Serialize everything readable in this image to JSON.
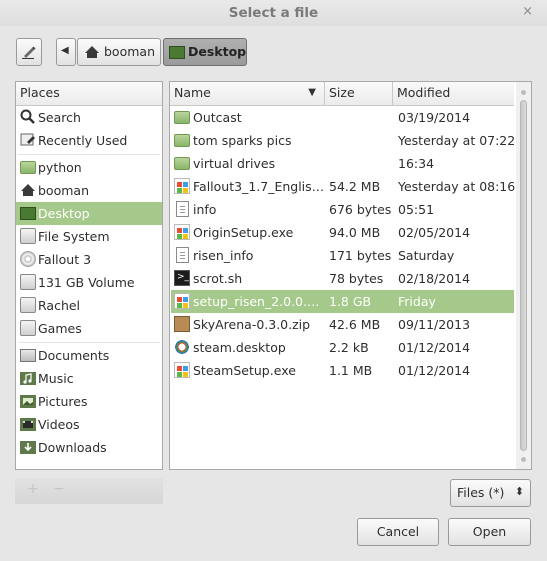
{
  "window": {
    "title": "Select a file",
    "close_glyph": "×"
  },
  "toolbar": {
    "edit_icon": "pencil-icon",
    "back_glyph": "◀",
    "path": [
      {
        "label": "booman",
        "icon": "home-icon"
      },
      {
        "label": "Desktop",
        "icon": "desktop-icon"
      }
    ]
  },
  "places": {
    "header": "Places",
    "groups": [
      [
        {
          "label": "Search",
          "icon": "search-icon"
        },
        {
          "label": "Recently Used",
          "icon": "recent-icon"
        }
      ],
      [
        {
          "label": "python",
          "icon": "folder-icon"
        },
        {
          "label": "booman",
          "icon": "home-icon"
        },
        {
          "label": "Desktop",
          "icon": "desktop-icon",
          "selected": true
        },
        {
          "label": "File System",
          "icon": "drive-icon"
        },
        {
          "label": "Fallout 3",
          "icon": "disc-icon"
        },
        {
          "label": "131 GB Volume",
          "icon": "drive-icon"
        },
        {
          "label": "Rachel",
          "icon": "drive-icon"
        },
        {
          "label": "Games",
          "icon": "drive-icon"
        }
      ],
      [
        {
          "label": "Documents",
          "icon": "documents-icon"
        },
        {
          "label": "Music",
          "icon": "music-icon"
        },
        {
          "label": "Pictures",
          "icon": "pictures-icon"
        },
        {
          "label": "Videos",
          "icon": "videos-icon"
        },
        {
          "label": "Downloads",
          "icon": "downloads-icon"
        }
      ]
    ],
    "add_glyph": "+",
    "remove_glyph": "−"
  },
  "files": {
    "columns": {
      "name": "Name",
      "size": "Size",
      "modified": "Modified",
      "sort_glyph": "▼"
    },
    "rows": [
      {
        "name": "Outcast",
        "size": "",
        "modified": "03/19/2014",
        "icon": "folder-icon"
      },
      {
        "name": "tom sparks pics",
        "size": "",
        "modified": "Yesterday at 07:22",
        "icon": "folder-icon"
      },
      {
        "name": "virtual drives",
        "size": "",
        "modified": "16:34",
        "icon": "folder-icon"
      },
      {
        "name": "Fallout3_1.7_Englis…",
        "size": "54.2 MB",
        "modified": "Yesterday at 08:16",
        "icon": "executable-icon"
      },
      {
        "name": "info",
        "size": "676 bytes",
        "modified": "05:51",
        "icon": "text-file-icon"
      },
      {
        "name": "OriginSetup.exe",
        "size": "94.0 MB",
        "modified": "02/05/2014",
        "icon": "executable-icon"
      },
      {
        "name": "risen_info",
        "size": "171 bytes",
        "modified": "Saturday",
        "icon": "text-file-icon"
      },
      {
        "name": " scrot.sh",
        "size": "78 bytes",
        "modified": "02/18/2014",
        "icon": "terminal-icon"
      },
      {
        "name": "setup_risen_2.0.0.…",
        "size": "1.8 GB",
        "modified": "Friday",
        "icon": "executable-icon",
        "selected": true
      },
      {
        "name": "SkyArena-0.3.0.zip",
        "size": "42.6 MB",
        "modified": "09/11/2013",
        "icon": "archive-icon"
      },
      {
        "name": "steam.desktop",
        "size": "2.2 kB",
        "modified": "01/12/2014",
        "icon": "launcher-icon"
      },
      {
        "name": "SteamSetup.exe",
        "size": "1.1 MB",
        "modified": "01/12/2014",
        "icon": "executable-icon"
      }
    ]
  },
  "filter": {
    "label": "Files (*)",
    "arrow": "⬍"
  },
  "actions": {
    "cancel": "Cancel",
    "open": "Open"
  },
  "colors": {
    "selection": "#a4c98a",
    "accent_folder": "#8ab56a"
  }
}
